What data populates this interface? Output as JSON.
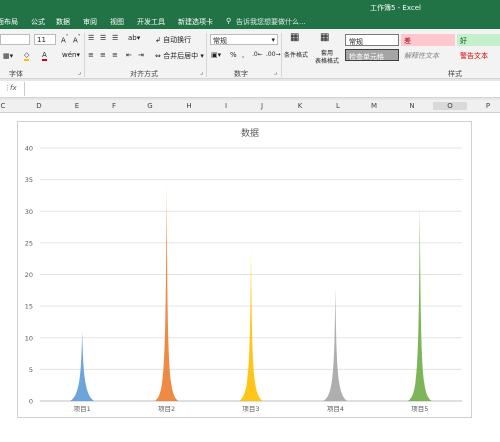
{
  "window": {
    "title": "工作簿5 - Excel"
  },
  "tabs": [
    "页面布局",
    "公式",
    "数据",
    "审阅",
    "视图",
    "开发工具",
    "新建选项卡"
  ],
  "tellme": "告诉我您想要做什么...",
  "ribbon": {
    "font_size": "11",
    "wrap_text": "自动换行",
    "merge_center": "合并后居中",
    "number_format": "常规",
    "percent": "%",
    "cond_format": "条件格式",
    "table_format": "套用\n表格格式",
    "styles": {
      "normal": "常规",
      "bad": "差",
      "good": "好",
      "check_cell": "检查单元格",
      "explanatory": "解释性文本",
      "warning": "警告文本"
    },
    "groups": {
      "font": "字体",
      "alignment": "对齐方式",
      "number": "数字",
      "styles": "样式"
    }
  },
  "fx_label": "fx",
  "columns": [
    "C",
    "D",
    "E",
    "F",
    "G",
    "H",
    "I",
    "J",
    "K",
    "L",
    "M",
    "N",
    "O",
    "P"
  ],
  "colors": {
    "excel_green": "#217346",
    "series": [
      "#5b9bd5",
      "#ed7d31",
      "#ffc000",
      "#a5a5a5",
      "#70ad47"
    ]
  },
  "chart_data": {
    "type": "bar",
    "title": "数据",
    "categories": [
      "项目1",
      "项目2",
      "项目3",
      "项目4",
      "项目5"
    ],
    "values": [
      11,
      34,
      24,
      18,
      31
    ],
    "ylim": [
      0,
      40
    ],
    "yticks": [
      0,
      5,
      10,
      15,
      20,
      25,
      30,
      35,
      40
    ],
    "grid": true
  }
}
